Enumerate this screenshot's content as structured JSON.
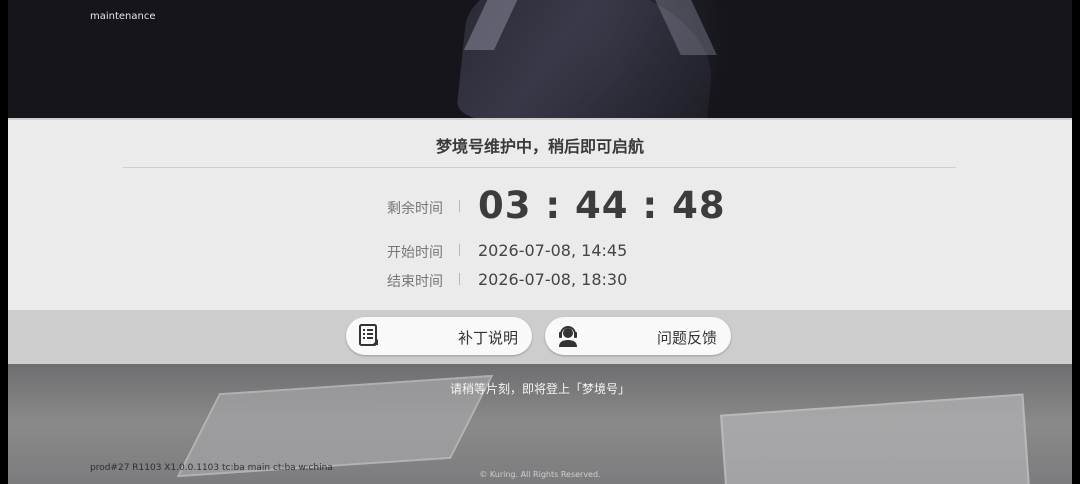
{
  "header": {
    "maintenance_label": "maintenance"
  },
  "panel": {
    "title": "梦境号维护中，稍后即可启航",
    "remaining_label": "剩余时间",
    "countdown": "03 : 44 : 48",
    "start_label": "开始时间",
    "start_value": "2026-07-08, 14:45",
    "end_label": "结束时间",
    "end_value": "2026-07-08, 18:30"
  },
  "buttons": {
    "patch_notes": {
      "label": "补丁说明",
      "icon": "document-icon"
    },
    "feedback": {
      "label": "问题反馈",
      "icon": "headset-support-icon"
    }
  },
  "footer": {
    "wait_text": "请稍等片刻，即将登上「梦境号」",
    "build_info": "prod#27 R1103 X1.0.0.1103 tc:ba main ct:ba w:china",
    "copyright": "© Kuring. All Rights Reserved."
  }
}
